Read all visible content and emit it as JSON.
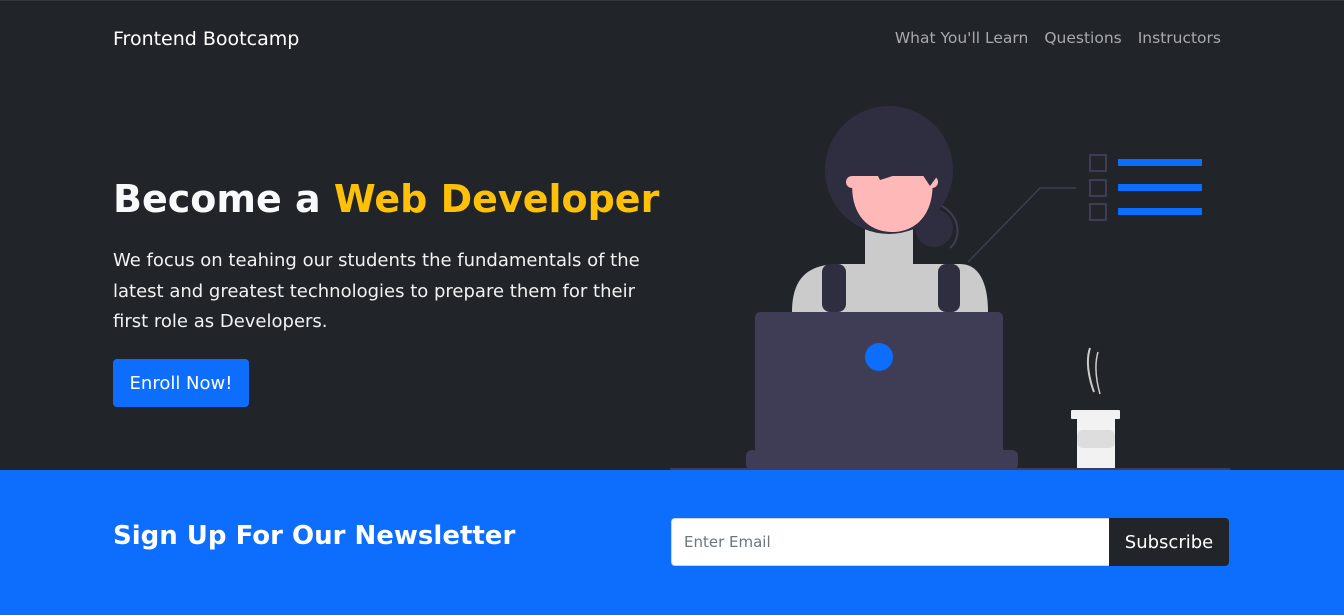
{
  "navbar": {
    "brand": "Frontend Bootcamp",
    "links": [
      {
        "label": "What You'll Learn"
      },
      {
        "label": "Questions"
      },
      {
        "label": "Instructors"
      }
    ]
  },
  "hero": {
    "title_prefix": "Become a ",
    "title_accent": "Web Developer",
    "lead": "We focus on teahing our students the fundamentals of the latest and greatest technologies to prepare them for their first role as Developers.",
    "cta_label": "Enroll Now!"
  },
  "newsletter": {
    "title": "Sign Up For Our Newsletter",
    "email_placeholder": "Enter Email",
    "email_value": "",
    "subscribe_label": "Subscribe"
  },
  "colors": {
    "background_dark": "#212529",
    "primary": "#0d6efd",
    "accent": "#ffc107",
    "text_light": "#f8f9fa",
    "nav_link": "#a7a9ac"
  },
  "icons": {
    "hero_illustration": "woman-at-laptop-illustration",
    "checklist": "checklist-icon",
    "coffee": "coffee-cup-icon"
  }
}
